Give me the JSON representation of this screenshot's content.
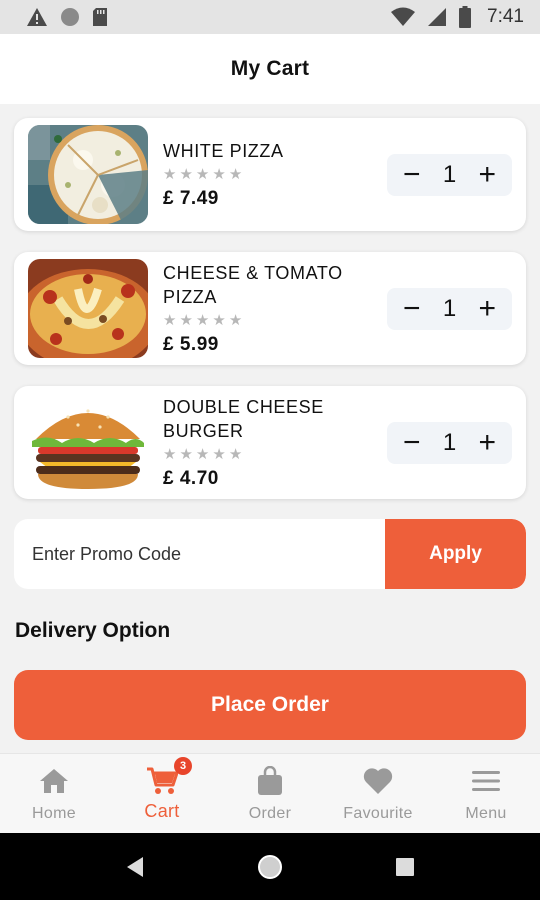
{
  "status_bar": {
    "time": "7:41",
    "icons": [
      "warning-icon",
      "circle-icon",
      "sd-card-icon",
      "wifi-icon",
      "signal-icon",
      "battery-icon"
    ]
  },
  "header": {
    "title": "My Cart"
  },
  "cart": {
    "items": [
      {
        "name": "WHITE PIZZA",
        "price": "£ 7.49",
        "quantity": "1",
        "rating": 0,
        "image": "white-pizza-image"
      },
      {
        "name": "CHEESE & TOMATO PIZZA",
        "price": "£ 5.99",
        "quantity": "1",
        "rating": 0,
        "image": "cheese-tomato-pizza-image"
      },
      {
        "name": "DOUBLE CHEESE BURGER",
        "price": "£ 4.70",
        "quantity": "1",
        "rating": 0,
        "image": "double-cheese-burger-image"
      }
    ],
    "minus_symbol": "−",
    "plus_symbol": "+"
  },
  "promo": {
    "placeholder": "Enter Promo Code",
    "apply_label": "Apply"
  },
  "delivery": {
    "label": "Delivery Option"
  },
  "place_order": {
    "label": "Place Order"
  },
  "bottom_nav": {
    "items": [
      {
        "label": "Home",
        "icon": "home-icon"
      },
      {
        "label": "Cart",
        "icon": "cart-icon",
        "badge": "3",
        "active": true
      },
      {
        "label": "Order",
        "icon": "bag-icon"
      },
      {
        "label": "Favourite",
        "icon": "heart-icon"
      },
      {
        "label": "Menu",
        "icon": "menu-icon"
      }
    ]
  },
  "colors": {
    "accent": "#ee5f3a",
    "badge": "#e8452b",
    "inactive": "#9a9a9a"
  }
}
